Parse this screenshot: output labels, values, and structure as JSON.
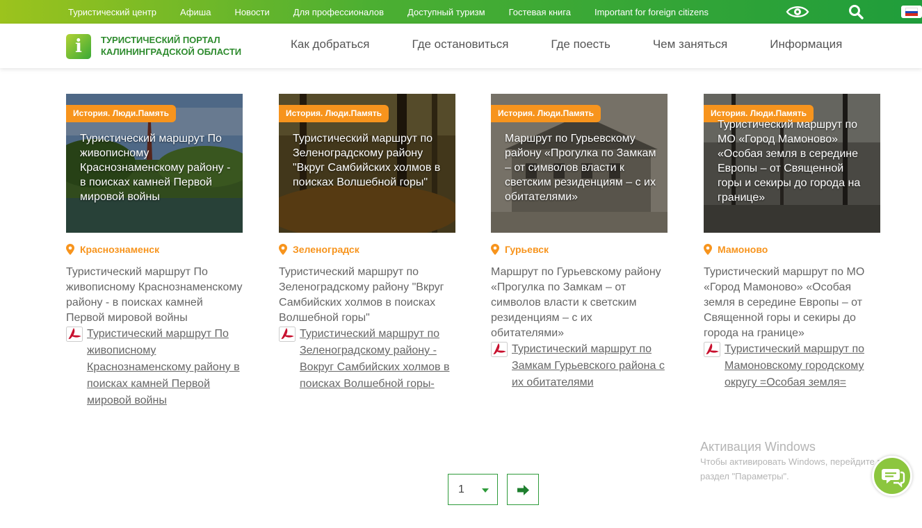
{
  "topbar": {
    "links": [
      "Туристический центр",
      "Афиша",
      "Новости",
      "Для профессионалов",
      "Доступный туризм",
      "Гостевая книга",
      "Important for foreign citizens"
    ],
    "eye_icon": "eye-icon",
    "search_icon": "search-icon",
    "lang_icon": "russian-flag-icon"
  },
  "header": {
    "logo_letter": "i",
    "logo_text": "Туристический портал Калининградской области",
    "nav": [
      "Как добраться",
      "Где остановиться",
      "Где поесть",
      "Чем заняться",
      "Информация"
    ]
  },
  "cards": [
    {
      "tag": "История. Люди.Память",
      "title": "Туристический маршрут По живописному Краснознаменскому району - в поисках камней Первой мировой войны",
      "city": "Краснознаменск",
      "desc": "Туристический маршрут По живописному Краснознаменскому району - в поисках камней Первой мировой войны",
      "pdf": "Туристический маршрут По живописному Краснознаменскому району в поисках камней Первой мировой войны"
    },
    {
      "tag": "История. Люди.Память",
      "title": "Туристический маршрут по Зеленоградскому району \"Вкруг Самбийских холмов в поисках Волшебной горы\"",
      "city": "Зеленоградск",
      "desc": "Туристический маршрут по Зеленоградскому району \"Вкруг Самбийских холмов в поисках Волшебной горы\"",
      "pdf": "Туристический маршрут по Зеленоградскому району - Вокруг Самбийских холмов в поисках Волшебной горы-"
    },
    {
      "tag": "История. Люди.Память",
      "title": "Маршрут по Гурьевскому району «Прогулка по Замкам – от символов власти к светским резиденциям – с их обитателями»",
      "city": "Гурьевск",
      "desc": "Маршрут по Гурьевскому району «Прогулка по Замкам – от символов власти к светским резиденциям – с их обитателями»",
      "pdf": "Туристический маршрут по Замкам Гурьевского района с их обитателями"
    },
    {
      "tag": "История. Люди.Память",
      "title": "Туристический маршрут по МО «Город Мамоново» «Особая земля в середине Европы – от Священной горы и секиры до города на границе»",
      "city": "Мамоново",
      "desc": "Туристический маршрут по МО «Город Мамоново» «Особая земля в середине Европы – от Священной горы и секиры до города на границе»",
      "pdf": "Туристический маршрут по Мамоновскому городскому округу =Особая земля="
    }
  ],
  "pager": {
    "current_page": "1",
    "next_icon": "arrow-right-icon"
  },
  "watermark": {
    "title": "Активация Windows",
    "text": "Чтобы активировать Windows, перейдите в раздел \"Параметры\"."
  },
  "chat_icon": "chat-bubble-icon",
  "colors": {
    "accent_green": "#2e9b3a",
    "tag_orange": "#f7941d",
    "chat_green": "#8cc63f"
  }
}
